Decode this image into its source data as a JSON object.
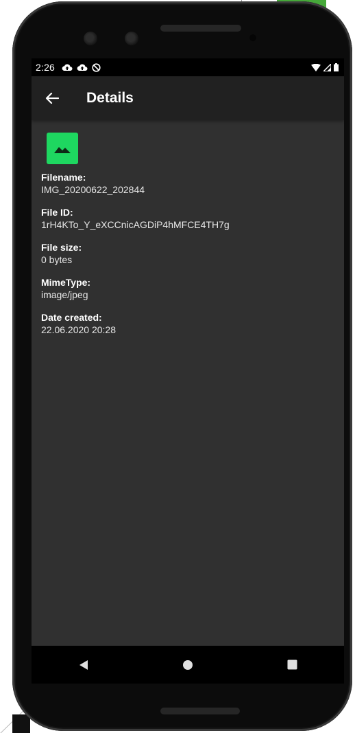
{
  "status_bar": {
    "time": "2:26",
    "icons": [
      "cloud-upload-icon",
      "cloud-upload-icon",
      "no-disturb-icon"
    ],
    "right_icons": [
      "wifi-icon",
      "signal-icon",
      "battery-icon"
    ]
  },
  "app_bar": {
    "title": "Details",
    "back_icon": "arrow-back-icon"
  },
  "file": {
    "icon": "image-icon",
    "icon_color": "#1ed760",
    "fields": [
      {
        "label": "Filename:",
        "value": "IMG_20200622_202844"
      },
      {
        "label": "File ID:",
        "value": "1rH4KTo_Y_eXCCnicAGDiP4hMFCE4TH7g"
      },
      {
        "label": "File size:",
        "value": "0 bytes"
      },
      {
        "label": "MimeType:",
        "value": "image/jpeg"
      },
      {
        "label": "Date created:",
        "value": "22.06.2020 20:28"
      }
    ]
  },
  "nav_bar": {
    "buttons": [
      "back-triangle-icon",
      "home-circle-icon",
      "recents-square-icon"
    ]
  },
  "colors": {
    "screen_bg": "#303030",
    "app_bar_bg": "#212121",
    "accent": "#1ed760"
  }
}
